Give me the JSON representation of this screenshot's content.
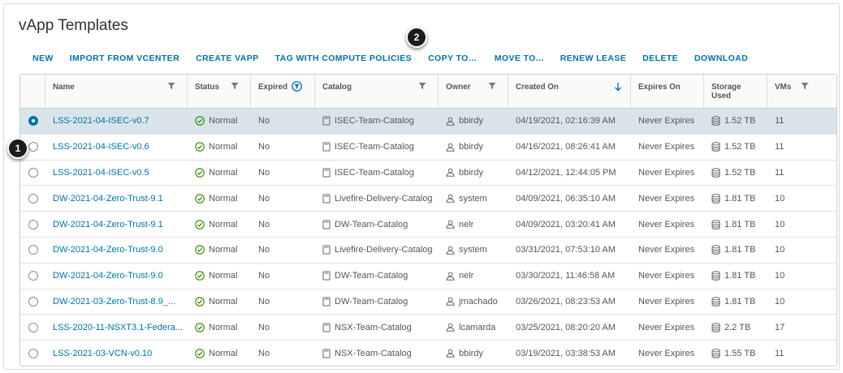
{
  "page": {
    "title": "vApp Templates"
  },
  "toolbar": [
    {
      "key": "new",
      "label": "NEW"
    },
    {
      "key": "import",
      "label": "IMPORT FROM VCENTER"
    },
    {
      "key": "create",
      "label": "CREATE VAPP"
    },
    {
      "key": "tag",
      "label": "TAG WITH COMPUTE POLICIES"
    },
    {
      "key": "copy",
      "label": "COPY TO..."
    },
    {
      "key": "move",
      "label": "MOVE TO..."
    },
    {
      "key": "renew",
      "label": "RENEW LEASE"
    },
    {
      "key": "delete",
      "label": "DELETE"
    },
    {
      "key": "download",
      "label": "DOWNLOAD"
    }
  ],
  "columns": {
    "name": "Name",
    "status": "Status",
    "expired": "Expired",
    "catalog": "Catalog",
    "owner": "Owner",
    "created": "Created On",
    "expires": "Expires On",
    "storage": "Storage Used",
    "storage_line1": "Storage",
    "storage_line2": "Used",
    "vms": "VMs"
  },
  "rows": [
    {
      "selected": true,
      "name": "LSS-2021-04-ISEC-v0.7",
      "status": "Normal",
      "expired": "No",
      "catalog": "ISEC-Team-Catalog",
      "owner": "bbirdy",
      "created": "04/19/2021, 02:16:39 AM",
      "expires": "Never Expires",
      "storage": "1.52 TB",
      "vms": "11"
    },
    {
      "selected": false,
      "name": "LSS-2021-04-ISEC-v0.6",
      "status": "Normal",
      "expired": "No",
      "catalog": "ISEC-Team-Catalog",
      "owner": "bbirdy",
      "created": "04/16/2021, 08:26:41 AM",
      "expires": "Never Expires",
      "storage": "1.52 TB",
      "vms": "11"
    },
    {
      "selected": false,
      "name": "LSS-2021-04-ISEC-v0.5",
      "status": "Normal",
      "expired": "No",
      "catalog": "ISEC-Team-Catalog",
      "owner": "bbirdy",
      "created": "04/12/2021, 12:44:05 PM",
      "expires": "Never Expires",
      "storage": "1.52 TB",
      "vms": "11"
    },
    {
      "selected": false,
      "name": "DW-2021-04-Zero-Trust-9.1",
      "status": "Normal",
      "expired": "No",
      "catalog": "Livefire-Delivery-Catalog",
      "owner": "system",
      "created": "04/09/2021, 06:35:10 AM",
      "expires": "Never Expires",
      "storage": "1.81 TB",
      "vms": "10"
    },
    {
      "selected": false,
      "name": "DW-2021-04-Zero-Trust-9.1",
      "status": "Normal",
      "expired": "No",
      "catalog": "DW-Team-Catalog",
      "owner": "nelr",
      "created": "04/09/2021, 03:20:41 AM",
      "expires": "Never Expires",
      "storage": "1.81 TB",
      "vms": "10"
    },
    {
      "selected": false,
      "name": "DW-2021-04-Zero-Trust-9.0",
      "status": "Normal",
      "expired": "No",
      "catalog": "Livefire-Delivery-Catalog",
      "owner": "system",
      "created": "03/31/2021, 07:53:10 AM",
      "expires": "Never Expires",
      "storage": "1.81 TB",
      "vms": "10"
    },
    {
      "selected": false,
      "name": "DW-2021-04-Zero-Trust-9.0",
      "status": "Normal",
      "expired": "No",
      "catalog": "DW-Team-Catalog",
      "owner": "nelr",
      "created": "03/30/2021, 11:46:58 AM",
      "expires": "Never Expires",
      "storage": "1.81 TB",
      "vms": "10"
    },
    {
      "selected": false,
      "name": "DW-2021-03-Zero-Trust-8.9_...",
      "status": "Normal",
      "expired": "No",
      "catalog": "DW-Team-Catalog",
      "owner": "jmachado",
      "created": "03/26/2021, 08:23:53 AM",
      "expires": "Never Expires",
      "storage": "1.81 TB",
      "vms": "10"
    },
    {
      "selected": false,
      "name": "LSS-2020-11-NSXT3.1-Federa...",
      "status": "Normal",
      "expired": "No",
      "catalog": "NSX-Team-Catalog",
      "owner": "lcamarda",
      "created": "03/25/2021, 08:20:20 AM",
      "expires": "Never Expires",
      "storage": "2.2 TB",
      "vms": "17"
    },
    {
      "selected": false,
      "name": "LSS-2021-03-VCN-v0.10",
      "status": "Normal",
      "expired": "No",
      "catalog": "NSX-Team-Catalog",
      "owner": "bbirdy",
      "created": "03/19/2021, 03:38:53 AM",
      "expires": "Never Expires",
      "storage": "1.55 TB",
      "vms": "11"
    }
  ],
  "callouts": [
    {
      "key": "one",
      "text": "1"
    },
    {
      "key": "two",
      "text": "2"
    }
  ],
  "colors": {
    "link": "#0072a3",
    "selected_row": "#d9e4ea",
    "status_ok": "#2f8400"
  },
  "icons": {
    "status": "check-circle-icon",
    "catalog": "catalog-book-icon",
    "owner": "user-icon",
    "storage": "storage-disk-icon",
    "filter": "filter-icon",
    "sort": "sort-down-arrow-icon"
  }
}
